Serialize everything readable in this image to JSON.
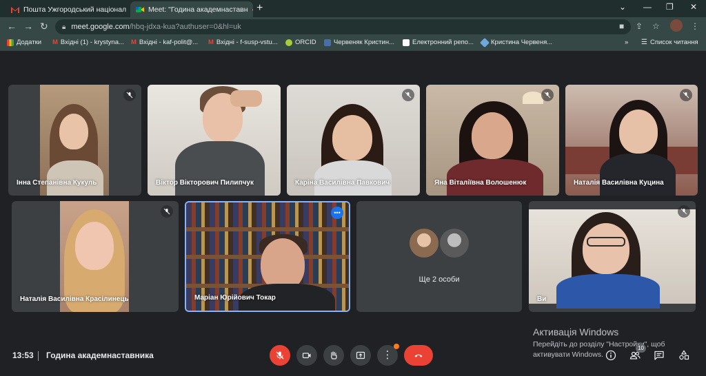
{
  "browser": {
    "tabs": [
      {
        "title": "Пошта Ужгородський націонал",
        "active": false
      },
      {
        "title": "Meet: \"Година академнаставн",
        "active": true
      }
    ],
    "url_host": "meet.google.com",
    "url_path": "/hbq-jdxa-kua?authuser=0&hl=uk",
    "bookmarks": [
      "Додатки",
      "Вхідні (1) - krystyna...",
      "Вхідні - kaf-polit@...",
      "Вхідні - f-susp-vstu...",
      "ORCID",
      "Червеняк Кристин...",
      "Електронний репо...",
      "Кристина Червеня..."
    ],
    "reading_list": "Список читання"
  },
  "participants": [
    {
      "name": "Інна Степанівна Кукуль",
      "muted": true
    },
    {
      "name": "Віктор Вікторович Пилипчук",
      "muted": false
    },
    {
      "name": "Каріна Василівна Павкович",
      "muted": true
    },
    {
      "name": "Яна Віталіївна Волошенюк",
      "muted": true
    },
    {
      "name": "Наталія Василівна Куцина",
      "muted": true
    },
    {
      "name": "Наталія Василівна Красілинець",
      "muted": true
    },
    {
      "name": "Маріан Юрійович Токар",
      "muted": false
    },
    {
      "name": "Ви",
      "muted": true
    }
  ],
  "more_people": "Ще 2 особи",
  "bottom": {
    "time": "13:53",
    "meeting_title": "Година академнаставника",
    "participants_count": "10"
  },
  "windows_activation": {
    "title": "Активація Windows",
    "text": "Перейдіть до розділу \"Настройки\", щоб активувати Windows."
  },
  "colors": {
    "accent_red": "#ea4335",
    "active_speaker_border": "#8ab4f8",
    "tile_bg": "#3c4043",
    "page_bg": "#202124"
  }
}
